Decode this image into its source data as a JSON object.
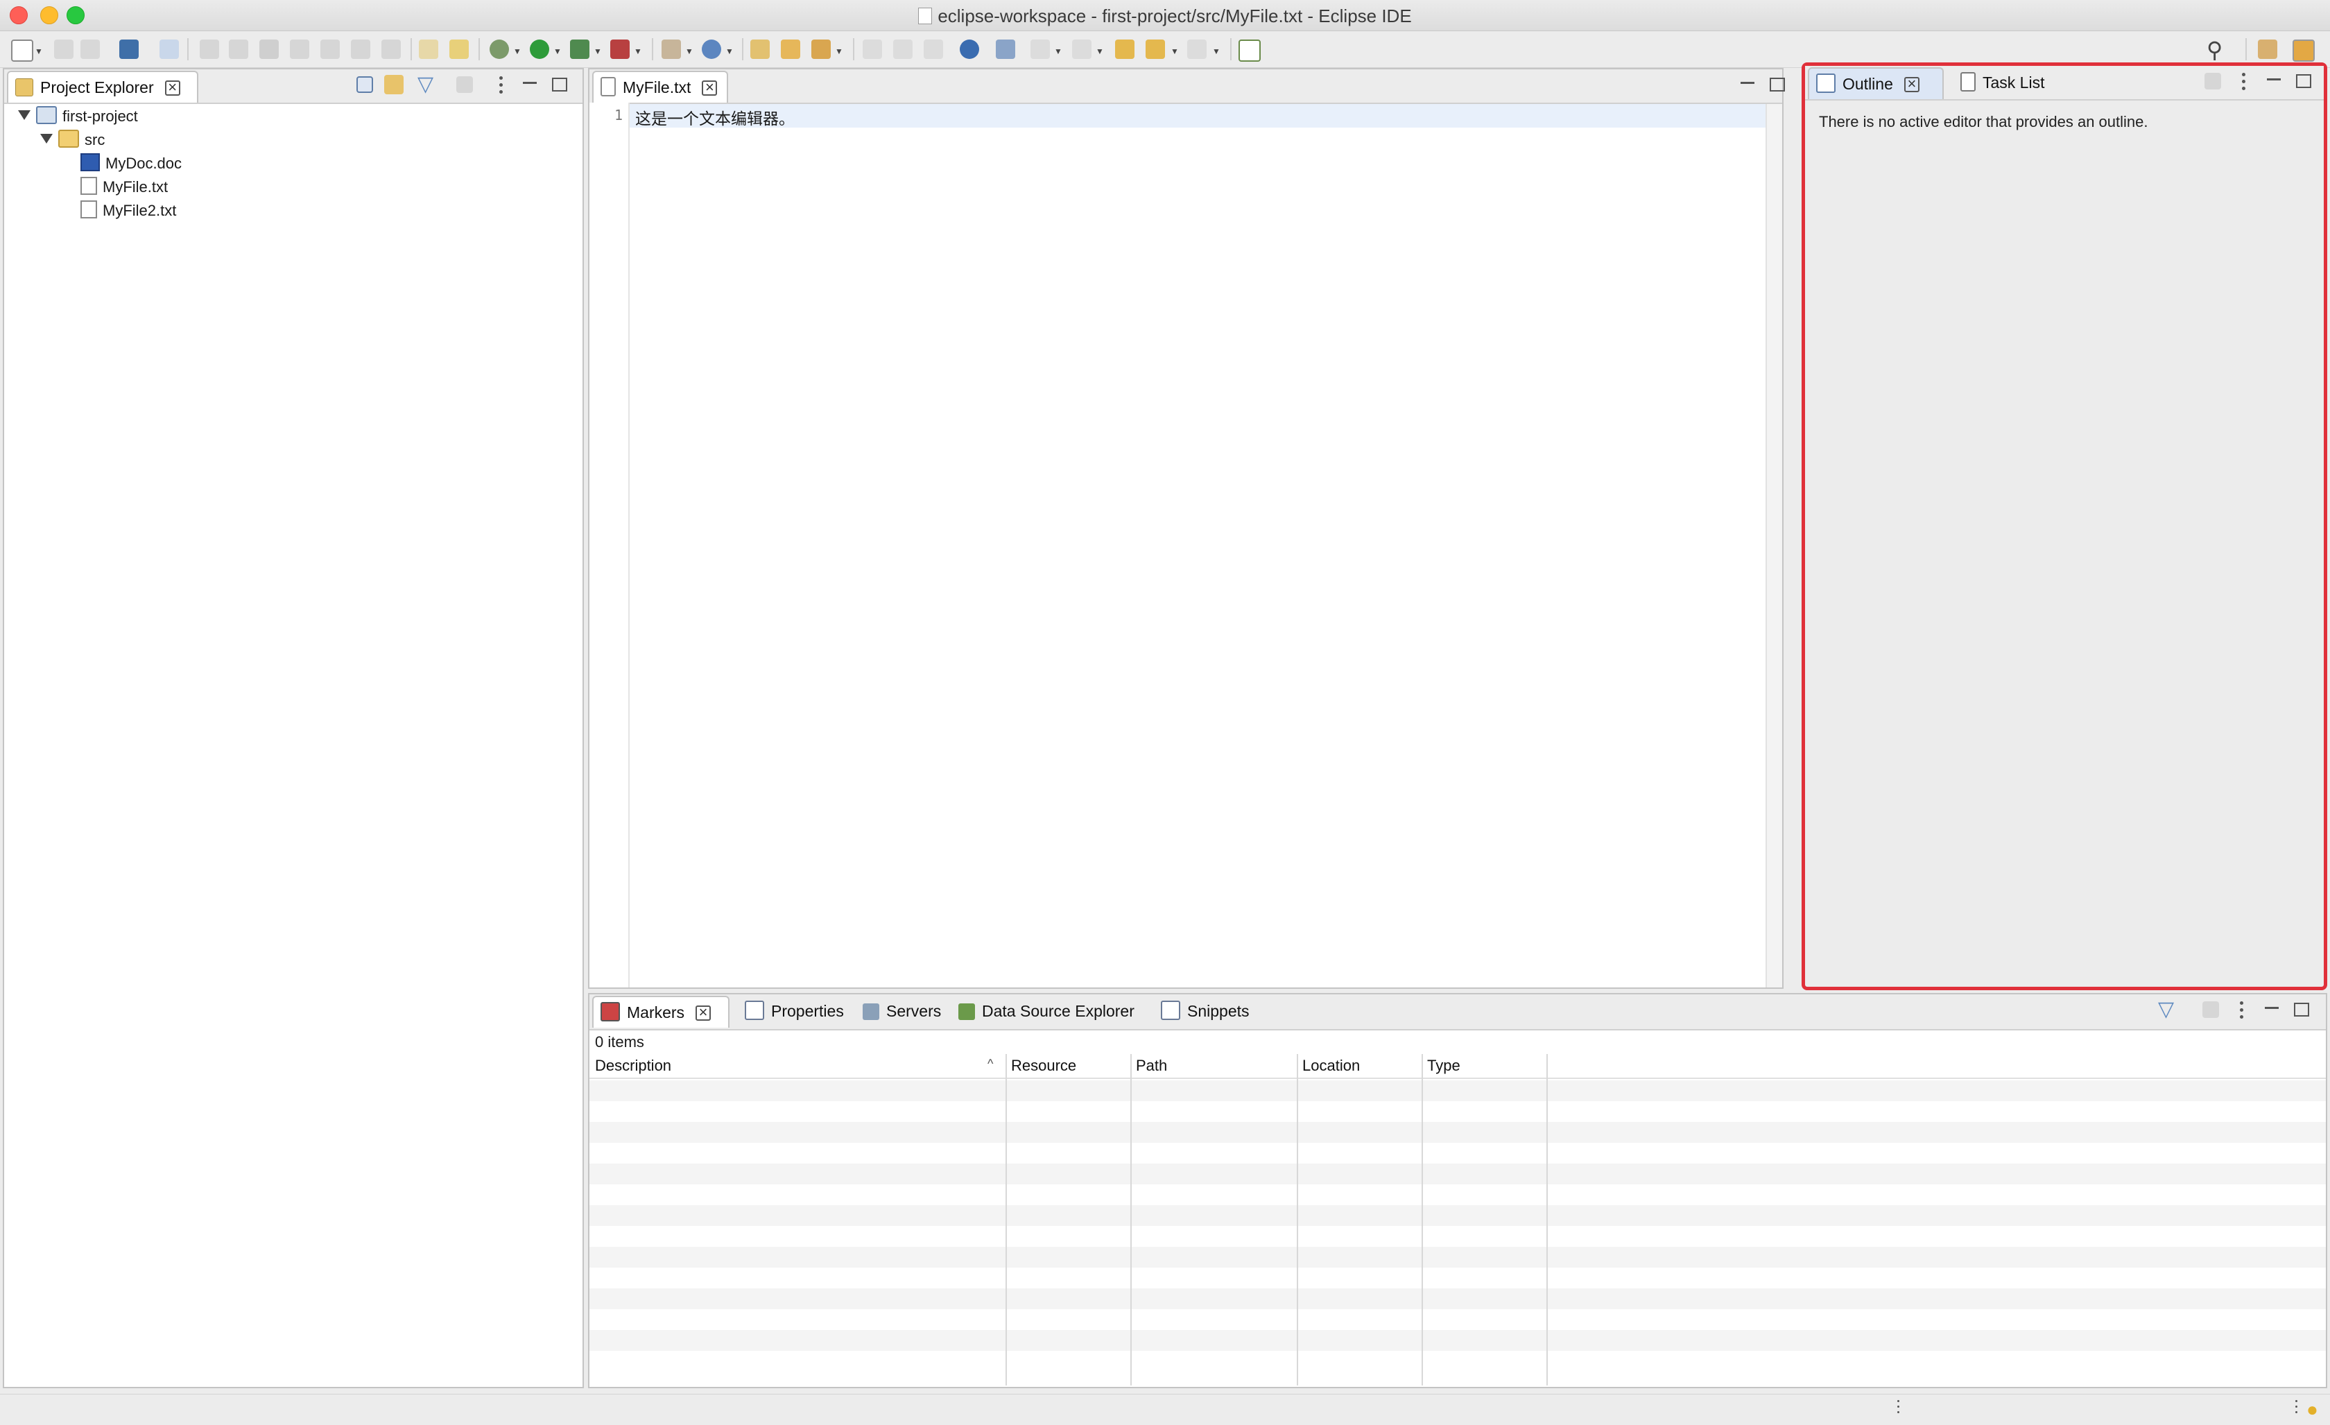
{
  "window": {
    "title": "eclipse-workspace - first-project/src/MyFile.txt - Eclipse IDE"
  },
  "project_explorer": {
    "tab_label": "Project Explorer",
    "tree": {
      "project": "first-project",
      "folder": "src",
      "files": [
        "MyDoc.doc",
        "MyFile.txt",
        "MyFile2.txt"
      ]
    }
  },
  "editor": {
    "tab_label": "MyFile.txt",
    "line_number": "1",
    "line_text": "这是一个文本编辑器。"
  },
  "outline": {
    "tabs": [
      "Outline",
      "Task List"
    ],
    "message": "There is no active editor that provides an outline."
  },
  "markers": {
    "tabs": [
      "Markers",
      "Properties",
      "Servers",
      "Data Source Explorer",
      "Snippets"
    ],
    "count": "0 items",
    "columns": [
      "Description",
      "Resource",
      "Path",
      "Location",
      "Type"
    ]
  },
  "colors": {
    "highlight_border": "#e0303a",
    "line_highlight": "#e8f0fb"
  }
}
